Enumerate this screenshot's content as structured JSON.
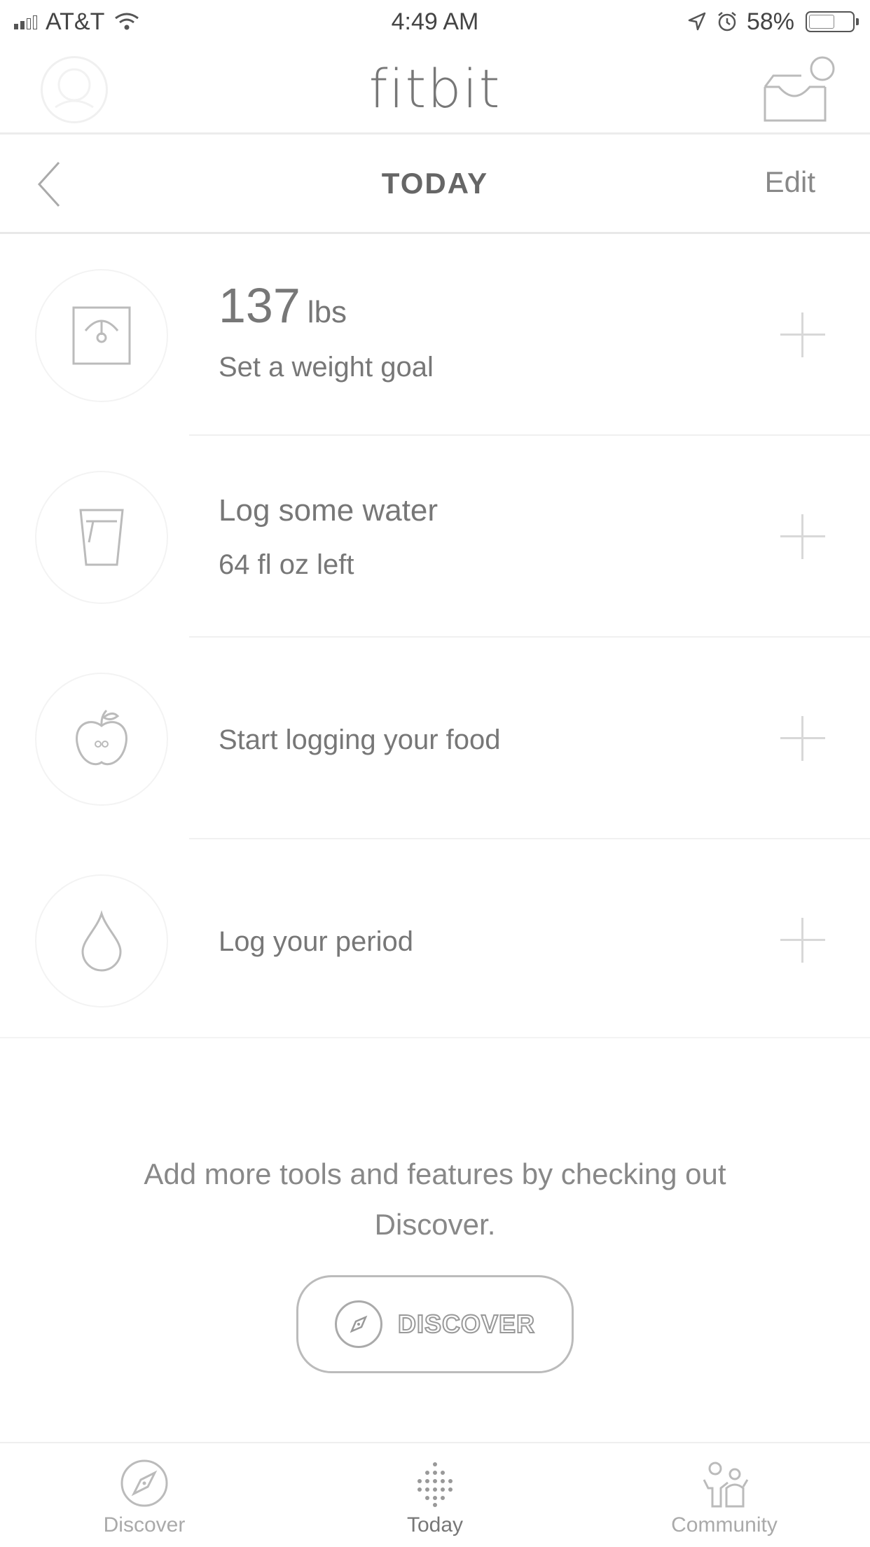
{
  "status_bar": {
    "carrier": "AT&T",
    "time": "4:49 AM",
    "battery": "58%",
    "battery_level": 0.58
  },
  "header": {
    "logo": "fitbit"
  },
  "subheader": {
    "title": "TODAY",
    "edit_label": "Edit"
  },
  "tiles": [
    {
      "value": "137",
      "unit": "lbs",
      "subtitle": "Set a weight goal",
      "icon": "scale-icon"
    },
    {
      "title": "Log some water",
      "subtitle": "64 fl oz left",
      "icon": "water-glass-icon"
    },
    {
      "title": "Start logging your food",
      "icon": "apple-icon"
    },
    {
      "title": "Log your period",
      "icon": "droplet-icon"
    }
  ],
  "promo": {
    "text": "Add more tools and features by checking out Discover.",
    "button_label": "DISCOVER"
  },
  "tab_bar": {
    "tabs": [
      {
        "label": "Discover",
        "icon": "compass-icon"
      },
      {
        "label": "Today",
        "icon": "dots-icon",
        "active": true
      },
      {
        "label": "Community",
        "icon": "community-icon"
      }
    ]
  }
}
